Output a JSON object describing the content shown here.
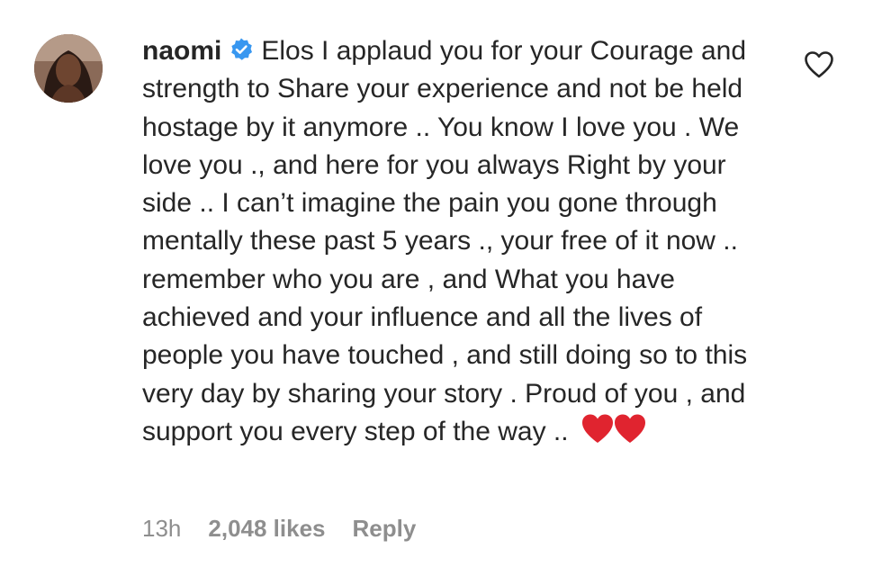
{
  "comment": {
    "username": "naomi",
    "verified": true,
    "text": "Elos I applaud you for your Courage and strength to Share your experience and not be held hostage by it anymore .. You know I love you . We love you ., and here for you always Right by your side .. I can’t imagine the pain you gone through mentally these past 5 years ., your free of it now .. remember who you are , and What you have achieved and your influence and all the lives of people you have touched , and still doing so to this very day by sharing your story . Proud of you , and support you every step of the way .. ",
    "emoji": "❤❤",
    "time": "13h",
    "likes": "2,048 likes",
    "reply": "Reply"
  },
  "colors": {
    "text": "#262626",
    "meta": "#8e8e8e",
    "verified_blue": "#3897f0",
    "emoji_red": "#e0242f"
  },
  "icons": {
    "verified": "verified-badge-icon",
    "like": "heart-outline-icon",
    "emoji": "red-heart-emoji"
  }
}
